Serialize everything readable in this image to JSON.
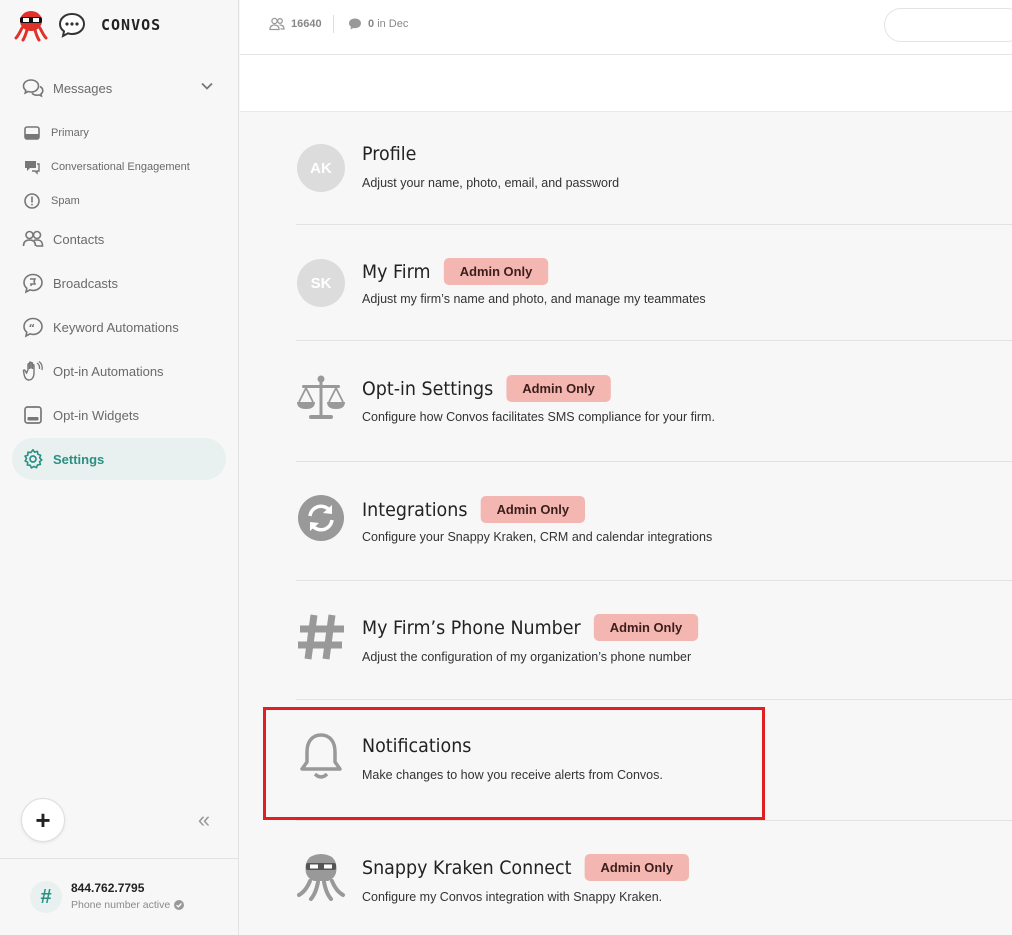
{
  "brand": {
    "name": "CONVOS"
  },
  "topbar": {
    "contacts_count": "16640",
    "messages_count": "0",
    "messages_suffix": "in Dec"
  },
  "sidebar": {
    "items": [
      {
        "label": "Messages",
        "icon": "messages-icon"
      },
      {
        "label": "Primary",
        "icon": "inbox-icon"
      },
      {
        "label": "Conversational Engagement",
        "icon": "engagement-icon"
      },
      {
        "label": "Spam",
        "icon": "alert-circle-icon"
      },
      {
        "label": "Contacts",
        "icon": "contacts-icon"
      },
      {
        "label": "Broadcasts",
        "icon": "broadcast-icon"
      },
      {
        "label": "Keyword Automations",
        "icon": "quote-bubble-icon"
      },
      {
        "label": "Opt-in Automations",
        "icon": "waving-hand-icon"
      },
      {
        "label": "Opt-in Widgets",
        "icon": "widget-icon"
      },
      {
        "label": "Settings",
        "icon": "gear-icon",
        "active": true
      }
    ],
    "add_label": "+",
    "collapse_label": "«"
  },
  "phone": {
    "number": "844.762.7795",
    "status": "Phone number active"
  },
  "settings": [
    {
      "title": "Profile",
      "desc": "Adjust your name, photo, email, and password",
      "avatar": "AK"
    },
    {
      "title": "My Firm",
      "desc": "Adjust my firm’s name and photo, and manage my teammates",
      "avatar": "SK",
      "badge": "Admin Only"
    },
    {
      "title": "Opt-in Settings",
      "desc": "Configure how Convos facilitates SMS compliance for your firm.",
      "icon": "scales-icon",
      "badge": "Admin Only"
    },
    {
      "title": "Integrations",
      "desc": "Configure your Snappy Kraken, CRM and calendar integrations",
      "icon": "sync-icon",
      "badge": "Admin Only"
    },
    {
      "title": "My Firm’s Phone Number",
      "desc": "Adjust the configuration of my organization’s phone number",
      "icon": "hash-icon",
      "badge": "Admin Only"
    },
    {
      "title": "Notifications",
      "desc": "Make changes to how you receive alerts from Convos.",
      "icon": "bell-icon"
    },
    {
      "title": "Snappy Kraken Connect",
      "desc": "Configure my Convos integration with Snappy Kraken.",
      "icon": "kraken-icon",
      "badge": "Admin Only"
    }
  ],
  "colors": {
    "accent": "#2b8f84",
    "badge_bg": "#f4b6b0",
    "highlight": "#e02020"
  }
}
